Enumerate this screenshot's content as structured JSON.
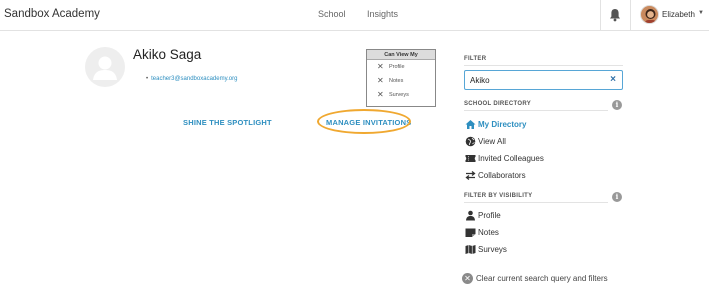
{
  "app": {
    "brand": "Sandbox Academy"
  },
  "nav": {
    "school": "School",
    "insights": "Insights"
  },
  "user": {
    "name": "Elizabeth",
    "caret": "▼"
  },
  "profile": {
    "name": "Akiko Saga",
    "email": "teacher3@sandboxacademy.org"
  },
  "can_view": {
    "header": "Can View My",
    "items": [
      {
        "label": "Profile",
        "icon": "x-icon"
      },
      {
        "label": "Notes",
        "icon": "x-icon"
      },
      {
        "label": "Surveys",
        "icon": "x-icon"
      }
    ]
  },
  "actions": {
    "shine": "SHINE THE SPOTLIGHT",
    "manage": "MANAGE INVITATIONS"
  },
  "highlight_color": "#f0a830",
  "accent_color": "#2e8fc0",
  "sidebar": {
    "filter_heading": "FILTER",
    "filter_value": "Akiko",
    "clear_x": "×",
    "directory_heading": "SCHOOL DIRECTORY",
    "directory_items": [
      {
        "label": "My Directory",
        "icon": "home-icon",
        "active": true
      },
      {
        "label": "View All",
        "icon": "globe-icon"
      },
      {
        "label": "Invited Colleagues",
        "icon": "ticket-icon"
      },
      {
        "label": "Collaborators",
        "icon": "swap-arrows-icon"
      }
    ],
    "visibility_heading": "FILTER BY VISIBILITY",
    "visibility_items": [
      {
        "label": "Profile",
        "icon": "person-icon"
      },
      {
        "label": "Notes",
        "icon": "note-icon"
      },
      {
        "label": "Surveys",
        "icon": "map-icon"
      }
    ],
    "info_glyph": "i",
    "clear_all": "Clear current search query and filters"
  }
}
